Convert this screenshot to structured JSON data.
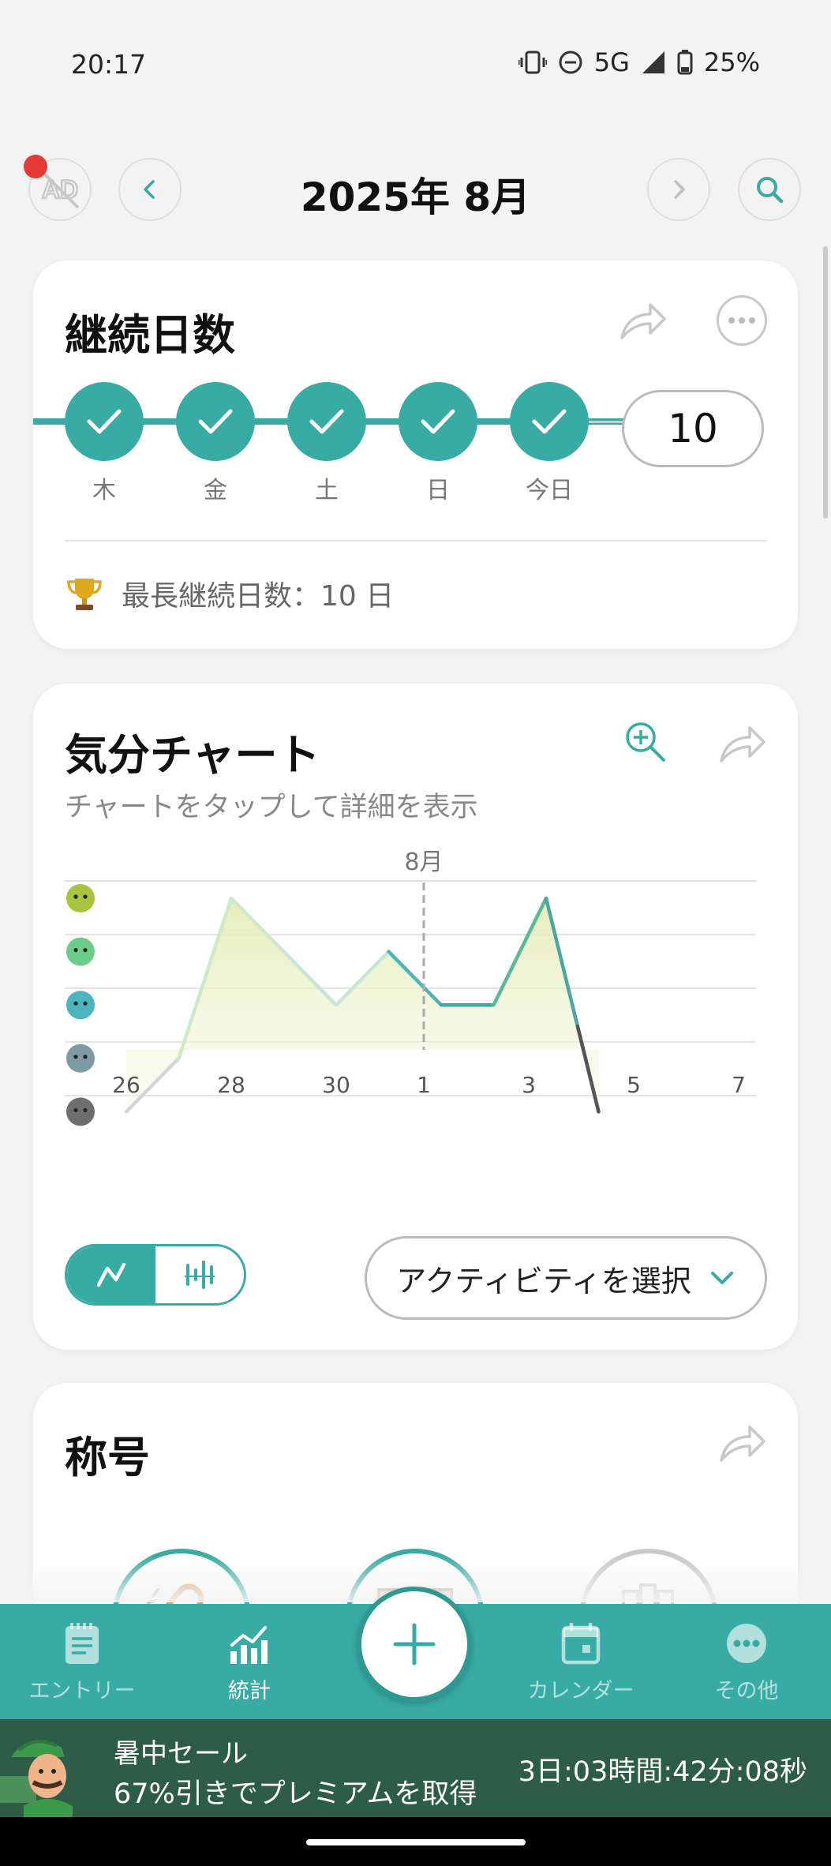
{
  "status_bar": {
    "time": "20:17",
    "network": "5G",
    "battery": "25%"
  },
  "header": {
    "title": "2025年 8月",
    "ad_label": "AD"
  },
  "streak": {
    "title": "継続日数",
    "days": [
      "木",
      "金",
      "土",
      "日",
      "今日"
    ],
    "count": "10",
    "longest": "最長継続日数：10 日"
  },
  "mood_chart": {
    "title": "気分チャート",
    "subtitle": "チャートをタップして詳細を表示",
    "month_marker": "8月",
    "activity_button": "アクティビティを選択"
  },
  "chart_data": {
    "type": "line",
    "x": [
      26,
      27,
      28,
      29,
      30,
      31,
      1,
      2,
      3,
      4
    ],
    "x_dates": [
      "7/26",
      "7/27",
      "7/28",
      "7/29",
      "7/30",
      "7/31",
      "8/1",
      "8/2",
      "8/3",
      "8/4"
    ],
    "values": [
      1,
      2,
      5,
      4,
      3,
      4,
      3,
      3,
      5,
      1
    ],
    "x_tick_labels": [
      "26",
      "28",
      "30",
      "1",
      "3",
      "5",
      "7"
    ],
    "ylim": [
      1,
      5
    ],
    "y_levels": [
      5,
      4,
      3,
      2,
      1
    ],
    "y_level_colors": [
      "#a8c43e",
      "#6ccd8a",
      "#4bb4bd",
      "#7e9aa5",
      "#6e6e6e"
    ],
    "grid": true,
    "area_fill": true
  },
  "titles_card": {
    "title": "称号"
  },
  "bottom_nav": {
    "items": [
      {
        "label": "エントリー",
        "icon": "notebook-icon"
      },
      {
        "label": "統計",
        "icon": "bar-chart-icon"
      },
      {
        "label": "カレンダー",
        "icon": "calendar-icon"
      },
      {
        "label": "その他",
        "icon": "more-dots-icon"
      }
    ]
  },
  "sale_banner": {
    "line1": "暑中セール",
    "line2": "67%引きでプレミアムを取得",
    "timer": "3日:03時間:42分:08秒"
  },
  "colors": {
    "accent": "#38aba4",
    "sale_bg": "#2d5d46",
    "notification": "#e53935"
  }
}
